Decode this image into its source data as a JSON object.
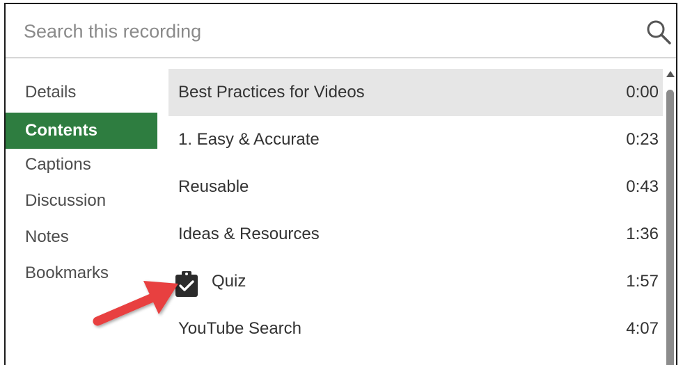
{
  "search": {
    "placeholder": "Search this recording",
    "icon": "search-icon"
  },
  "nav": {
    "items": [
      {
        "label": "Details",
        "active": false
      },
      {
        "label": "Contents",
        "active": true
      },
      {
        "label": "Captions",
        "active": false
      },
      {
        "label": "Discussion",
        "active": false
      },
      {
        "label": "Notes",
        "active": false
      },
      {
        "label": "Bookmarks",
        "active": false
      }
    ],
    "active_color": "#2e7d40"
  },
  "contents": {
    "rows": [
      {
        "title": "Best Practices for Videos",
        "time": "0:00",
        "selected": true
      },
      {
        "title": "1. Easy & Accurate",
        "time": "0:23"
      },
      {
        "title": "Reusable",
        "time": "0:43"
      },
      {
        "title": "Ideas & Resources",
        "time": "1:36"
      },
      {
        "title": "Quiz",
        "time": "1:57",
        "icon": "quiz-clipboard-check-icon"
      },
      {
        "title": "YouTube Search",
        "time": "4:07"
      }
    ]
  },
  "annotation": {
    "color": "#e8403f"
  }
}
